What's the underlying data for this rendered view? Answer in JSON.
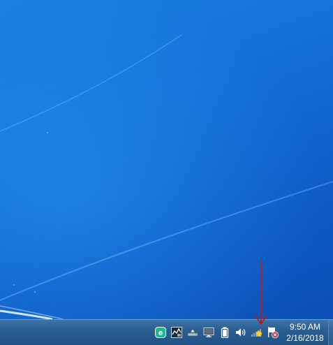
{
  "desktop": {
    "wallpaper": "windows-7-blue",
    "accent_color": "#1470d8"
  },
  "taskbar": {
    "color": "#2a5f93",
    "tray": {
      "icons": [
        {
          "name": "eset-antivirus-icon",
          "color": "#1db98c"
        },
        {
          "name": "network-monitor-icon"
        },
        {
          "name": "removable-drive-icon"
        },
        {
          "name": "display-monitor-icon"
        },
        {
          "name": "battery-icon"
        },
        {
          "name": "volume-speaker-icon"
        },
        {
          "name": "network-signal-warning-icon"
        },
        {
          "name": "action-center-flag-error-icon",
          "color": "#d9262c"
        }
      ],
      "clock": {
        "time": "9:50 AM",
        "date": "2/16/2018"
      }
    }
  },
  "annotation": {
    "arrow_color": "#b0202a",
    "points_to": "network-signal-warning-icon"
  }
}
